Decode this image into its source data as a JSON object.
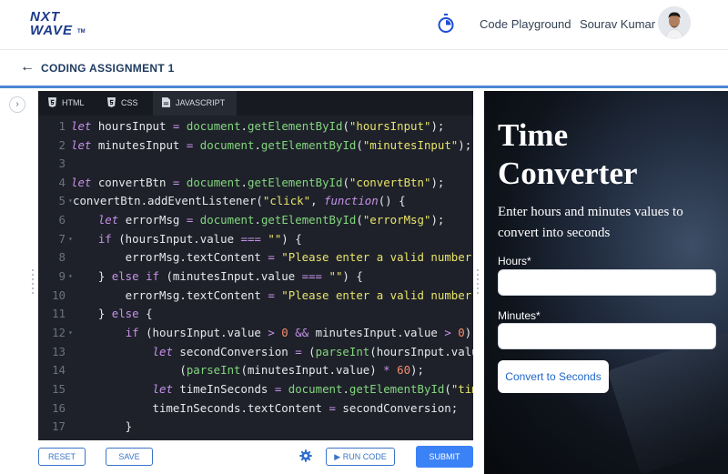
{
  "header": {
    "logo_line1": "NXT",
    "logo_line2": "WAVE",
    "logo_tm": "TM",
    "nav_playground": "Code Playground",
    "user_name": "Sourav Kumar"
  },
  "subheader": {
    "back_arrow": "←",
    "title": "CODING ASSIGNMENT 1"
  },
  "editor": {
    "tabs": [
      {
        "label": "HTML",
        "icon": "html5-icon"
      },
      {
        "label": "CSS",
        "icon": "css3-icon"
      },
      {
        "label": "JAVASCRIPT",
        "icon": "file-icon",
        "active": true
      }
    ],
    "line_numbers": [
      "1",
      "2",
      "3",
      "4",
      "5",
      "6",
      "7",
      "8",
      "9",
      "10",
      "11",
      "12",
      "13",
      "14",
      "15",
      "16",
      "17"
    ],
    "fold_markers": [
      "",
      "",
      "",
      "",
      "▾",
      "",
      "▾",
      "",
      "▾",
      "",
      "",
      "▾",
      "",
      "",
      "",
      "",
      ""
    ]
  },
  "footer": {
    "reset_label": "RESET",
    "save_label": "SAVE",
    "run_label": "▶ RUN CODE",
    "submit_label": "SUBMIT"
  },
  "preview": {
    "title_line1": "Time",
    "title_line2": "Converter",
    "description": "Enter hours and minutes values to convert into seconds",
    "hours_label": "Hours*",
    "minutes_label": "Minutes*",
    "convert_button": "Convert to Seconds"
  },
  "colors": {
    "accent": "#3b82f6",
    "brand": "#1b3a8a",
    "editor_bg": "#1e2129"
  }
}
